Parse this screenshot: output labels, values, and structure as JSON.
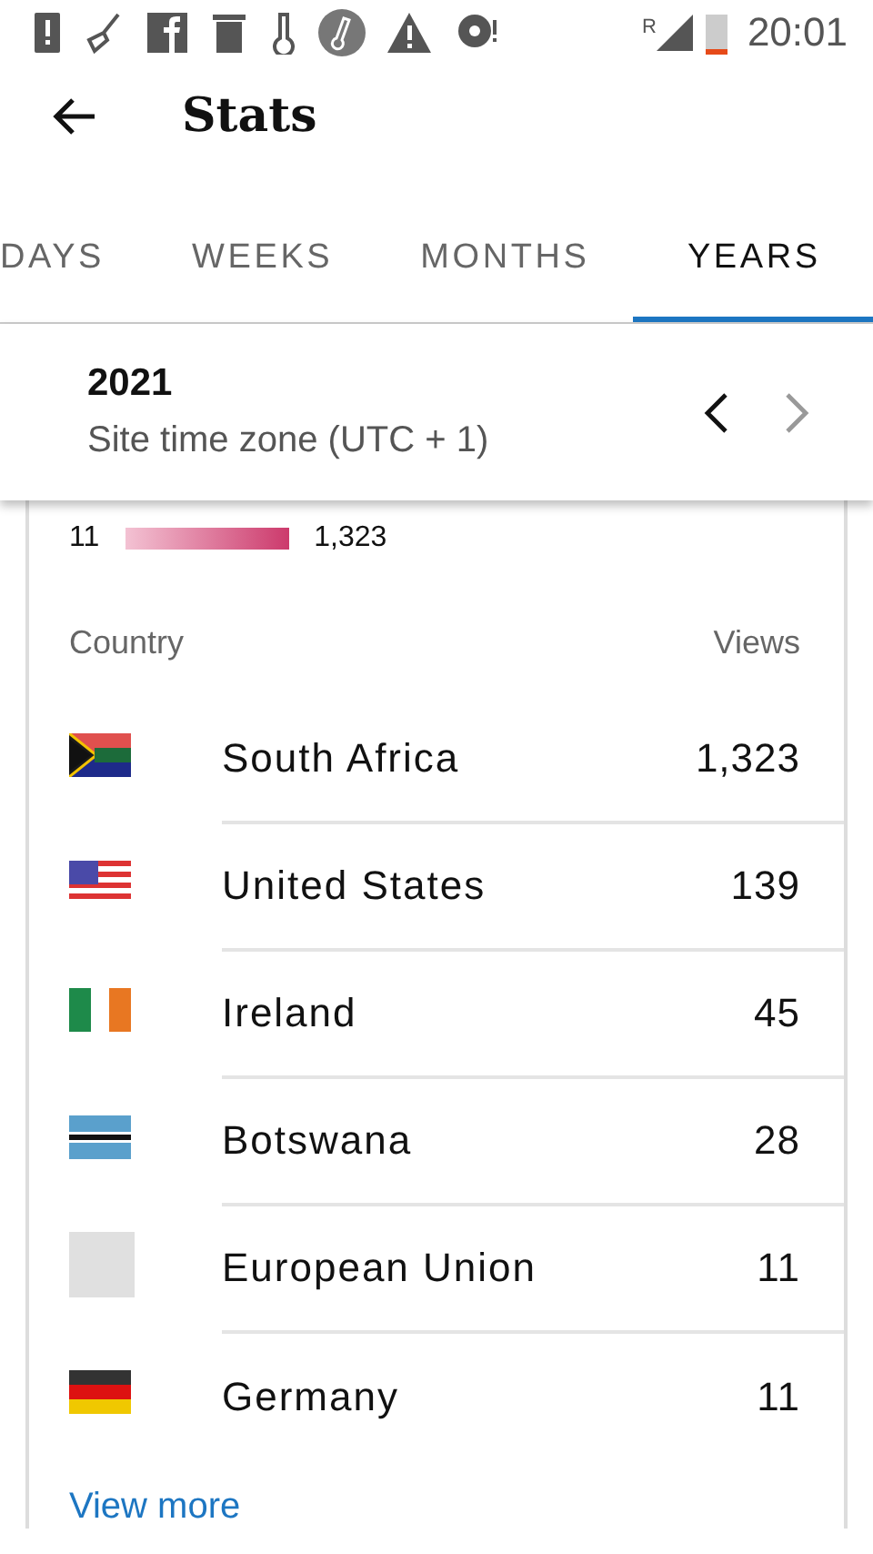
{
  "status_bar": {
    "time": "20:01",
    "signal_label": "R"
  },
  "toolbar": {
    "title": "Stats"
  },
  "tabs": [
    {
      "label": "DAYS",
      "selected": false
    },
    {
      "label": "WEEKS",
      "selected": false
    },
    {
      "label": "MONTHS",
      "selected": false
    },
    {
      "label": "YEARS",
      "selected": true
    }
  ],
  "date_bar": {
    "period": "2021",
    "timezone": "Site time zone (UTC + 1)",
    "previous_disabled": false,
    "next_disabled": true
  },
  "legend": {
    "min": "11",
    "max": "1,323"
  },
  "table": {
    "columns": [
      "Country",
      "Views"
    ],
    "rows": [
      {
        "kind": "za",
        "country": "South Africa",
        "views": "1,323"
      },
      {
        "kind": "us",
        "country": "United States",
        "views": "139"
      },
      {
        "kind": "ie",
        "country": "Ireland",
        "views": "45"
      },
      {
        "kind": "bw",
        "country": "Botswana",
        "views": "28"
      },
      {
        "kind": "eu",
        "country": "European Union",
        "views": "11"
      },
      {
        "kind": "de",
        "country": "Germany",
        "views": "11"
      }
    ]
  },
  "link": "View more"
}
